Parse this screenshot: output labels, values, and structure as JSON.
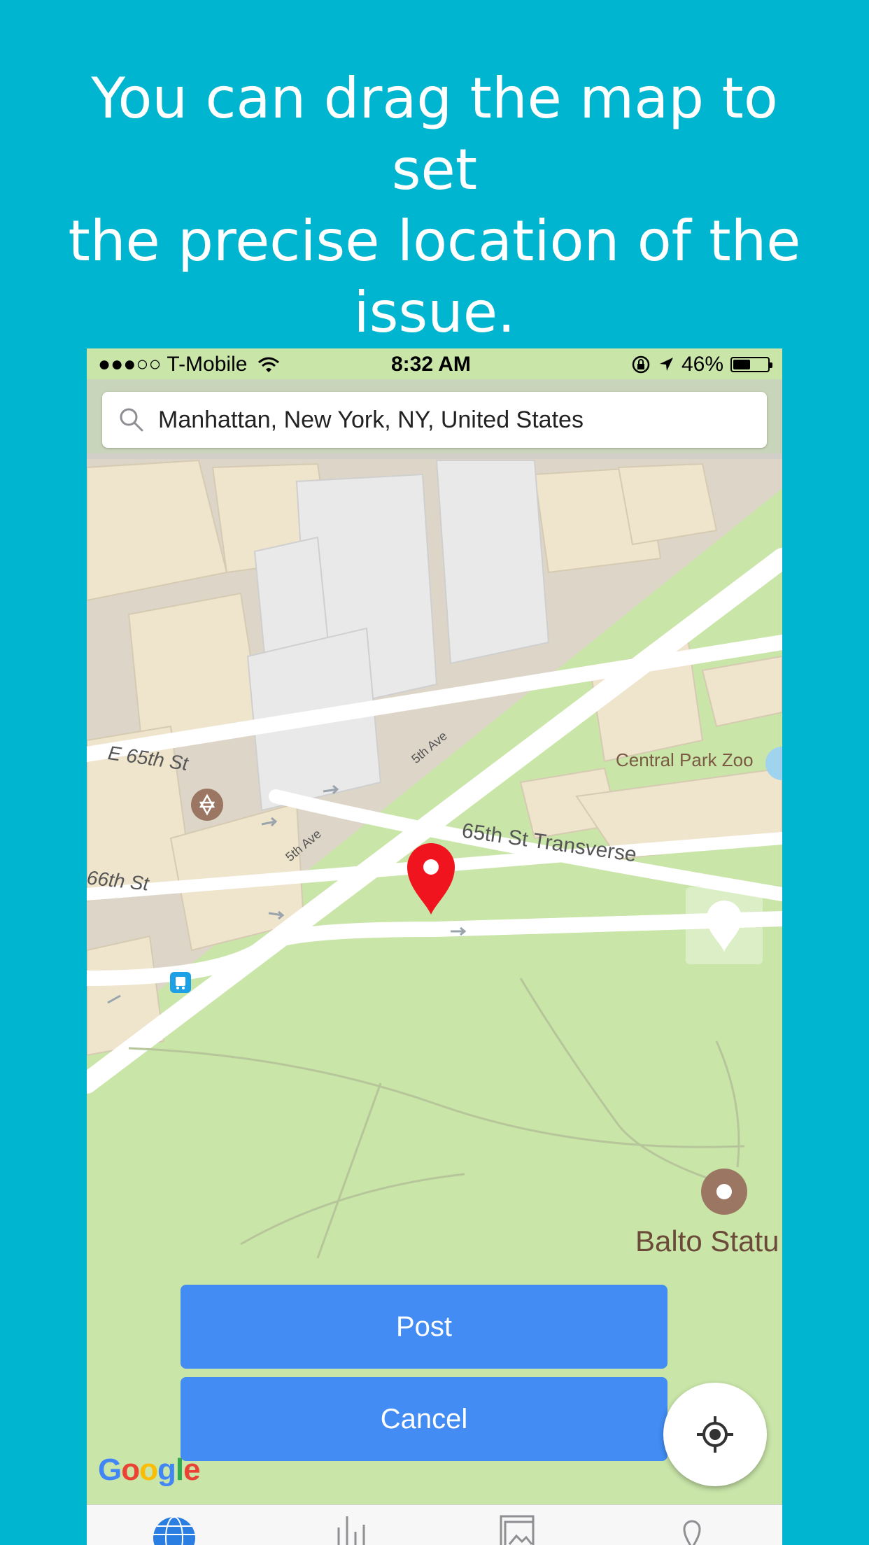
{
  "promo": {
    "line1": "You can drag the map to set",
    "line2": "the precise location of the",
    "line3": "issue."
  },
  "status_bar": {
    "carrier": "●●●○○ T-Mobile",
    "time": "8:32 AM",
    "battery": "46%",
    "battery_level": 0.46
  },
  "search": {
    "value": "Manhattan, New York, NY, United States"
  },
  "map": {
    "labels": {
      "e65": "E 65th St",
      "s66": "66th St",
      "fifth1": "5th Ave",
      "fifth2": "5th Ave",
      "transverse": "65th St Transverse",
      "zoo": "Central Park Zoo",
      "balto": "Balto Statu"
    },
    "colors": {
      "park": "#c9e5a8",
      "road": "#ffffff",
      "building": "#efe4cc",
      "pin": "#f0141e",
      "button": "#428cf3"
    }
  },
  "actions": {
    "post": "Post",
    "cancel": "Cancel"
  },
  "attribution": {
    "google": [
      "G",
      "o",
      "o",
      "g",
      "l",
      "e"
    ]
  },
  "tabs": [
    "globe-icon",
    "chart-icon",
    "gallery-icon",
    "pin-icon"
  ]
}
